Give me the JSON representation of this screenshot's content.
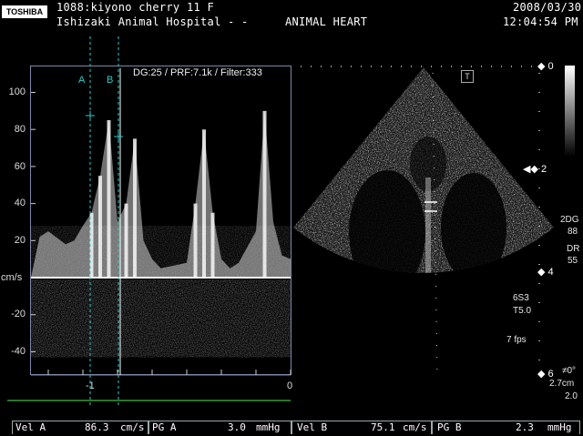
{
  "header": {
    "brand": "TOSHIBA",
    "patient_line": "1088:kiyono cherry  11  F",
    "institution": "Ishizaki Animal Hospital",
    "separator": "- -",
    "study": "ANIMAL HEART",
    "date": "2008/03/30",
    "time": "12:04:54 PM"
  },
  "doppler": {
    "info": "DG:25 /   PRF:7.1k   / Filter:333",
    "unit": "cm/s",
    "y_ticks": [
      "100",
      "80",
      "60",
      "40",
      "20",
      "-20",
      "-40"
    ],
    "x_ticks": [
      "-1",
      "0"
    ],
    "marker_a": "A",
    "marker_b": "B"
  },
  "chart_data": {
    "type": "line",
    "title": "",
    "xlabel": "",
    "ylabel": "cm/s",
    "ylim": [
      -50,
      110
    ],
    "y_ticks": [
      100,
      80,
      60,
      40,
      20,
      -20,
      -40
    ],
    "x_ticks": [
      -1,
      0
    ],
    "series": [
      {
        "x": [
          -1.45,
          -1.4,
          -1.3,
          -1.25,
          -1.2,
          -1.15,
          -1.1,
          -1.05,
          -1.0,
          -0.95,
          -0.9,
          -0.85,
          -0.8,
          -0.75,
          -0.6,
          -0.55,
          -0.5,
          -0.45,
          -0.4,
          -0.35,
          -0.3,
          -0.2,
          -0.15,
          -0.1,
          -0.05,
          0
        ],
        "values": [
          22,
          25,
          18,
          20,
          28,
          35,
          55,
          85,
          30,
          40,
          75,
          20,
          10,
          5,
          8,
          40,
          80,
          35,
          10,
          5,
          8,
          25,
          90,
          30,
          12,
          10
        ]
      }
    ],
    "markers": {
      "A": -1.05,
      "B": -0.87
    }
  },
  "right_panel": {
    "top_icon": "T",
    "depth_labels": [
      "0",
      "2",
      "4",
      "6"
    ],
    "params": [
      "2DG",
      "88",
      "DR",
      "55",
      "6S3",
      "T5.0",
      "7 fps"
    ],
    "angle": "≠0°",
    "depth_value": "2.7cm",
    "zoom": "2.0"
  },
  "measurements": {
    "vel_a_label": "Vel A",
    "vel_a_value": "86.3",
    "vel_a_unit": "cm/s",
    "pg_a_label": "PG A",
    "pg_a_value": "3.0",
    "pg_a_unit": "mmHg",
    "vel_b_label": "Vel B",
    "vel_b_value": "75.1",
    "vel_b_unit": "cm/s",
    "pg_b_label": "PG B",
    "pg_b_value": "2.3",
    "pg_b_unit": "mmHg"
  },
  "colors": {
    "cyan_marker": "#33c9c9",
    "green_line": "#3a9a3a",
    "frame": "#7a88a8"
  }
}
